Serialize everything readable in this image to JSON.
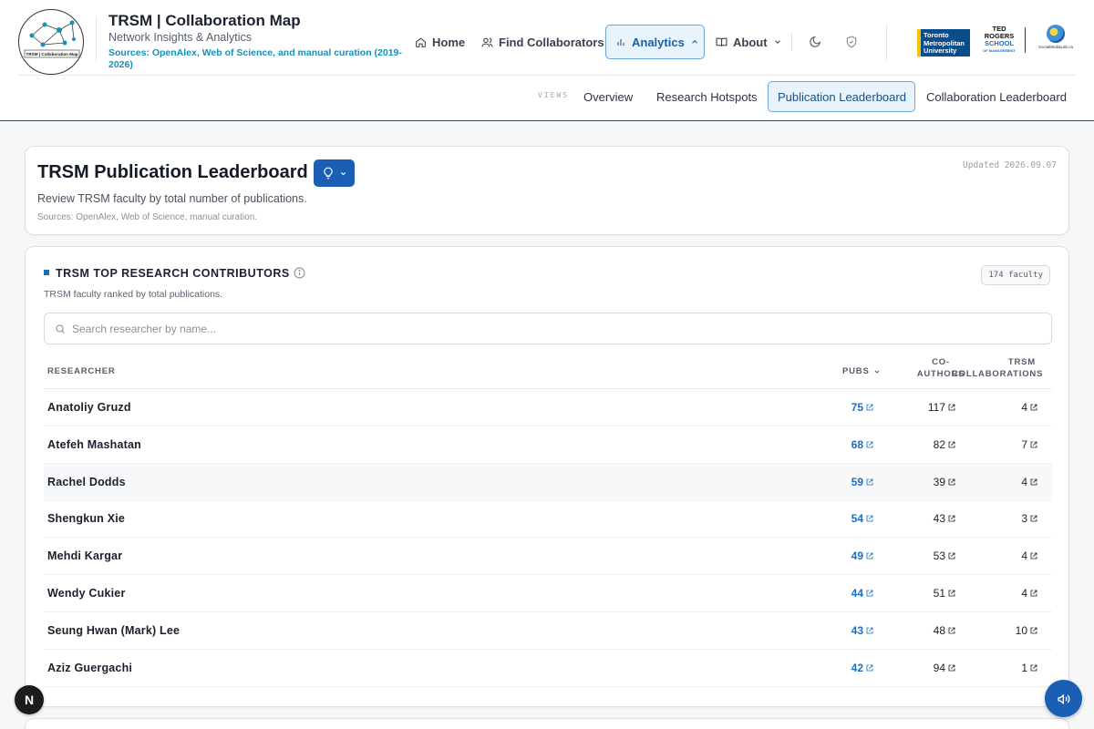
{
  "brand": {
    "logo_text": "TRSM | Collaboration Map",
    "title": "TRSM | Collaboration Map",
    "subtitle": "Network Insights & Analytics",
    "sources": "Sources: OpenAlex, Web of Science, and manual curation (2019-2026)"
  },
  "nav": {
    "home": "Home",
    "find": "Find Collaborators",
    "analytics": "Analytics",
    "about": "About"
  },
  "partners": {
    "tmu": [
      "Toronto",
      "Metropolitan",
      "University"
    ],
    "ted": [
      "TED",
      "ROGERS",
      "SCHOOL",
      "OF MANAGEMENT"
    ],
    "sml": "SocialMediaLab.ca"
  },
  "views": {
    "label": "VIEWS",
    "tabs": [
      "Overview",
      "Research Hotspots",
      "Publication Leaderboard",
      "Collaboration Leaderboard"
    ],
    "active": "Publication Leaderboard"
  },
  "page": {
    "title": "TRSM Publication Leaderboard",
    "description": "Review TRSM faculty by total number of publications.",
    "sources": "Sources: OpenAlex, Web of Science, manual curation.",
    "updated": "Updated 2026.09.07"
  },
  "section": {
    "title": "TRSM TOP RESEARCH CONTRIBUTORS",
    "subtitle": "TRSM faculty ranked by total publications.",
    "count": "174 faculty"
  },
  "search": {
    "placeholder": "Search researcher by name..."
  },
  "table": {
    "headers": {
      "researcher": "RESEARCHER",
      "pubs": "PUBS",
      "coauthors_1": "CO-",
      "coauthors_2": "AUTHORS",
      "trsm_1": "TRSM",
      "trsm_2": "COLLABORATIONS"
    },
    "rows": [
      {
        "name": "Anatoliy Gruzd",
        "pubs": "75",
        "coauthors": "117",
        "trsm": "4"
      },
      {
        "name": "Atefeh Mashatan",
        "pubs": "68",
        "coauthors": "82",
        "trsm": "7"
      },
      {
        "name": "Rachel Dodds",
        "pubs": "59",
        "coauthors": "39",
        "trsm": "4"
      },
      {
        "name": "Shengkun Xie",
        "pubs": "54",
        "coauthors": "43",
        "trsm": "3"
      },
      {
        "name": "Mehdi Kargar",
        "pubs": "49",
        "coauthors": "53",
        "trsm": "4"
      },
      {
        "name": "Wendy Cukier",
        "pubs": "44",
        "coauthors": "51",
        "trsm": "4"
      },
      {
        "name": "Seung Hwan (Mark) Lee",
        "pubs": "43",
        "coauthors": "48",
        "trsm": "10"
      },
      {
        "name": "Aziz Guergachi",
        "pubs": "42",
        "coauthors": "94",
        "trsm": "1"
      }
    ]
  },
  "floating": {
    "n_label": "N"
  }
}
